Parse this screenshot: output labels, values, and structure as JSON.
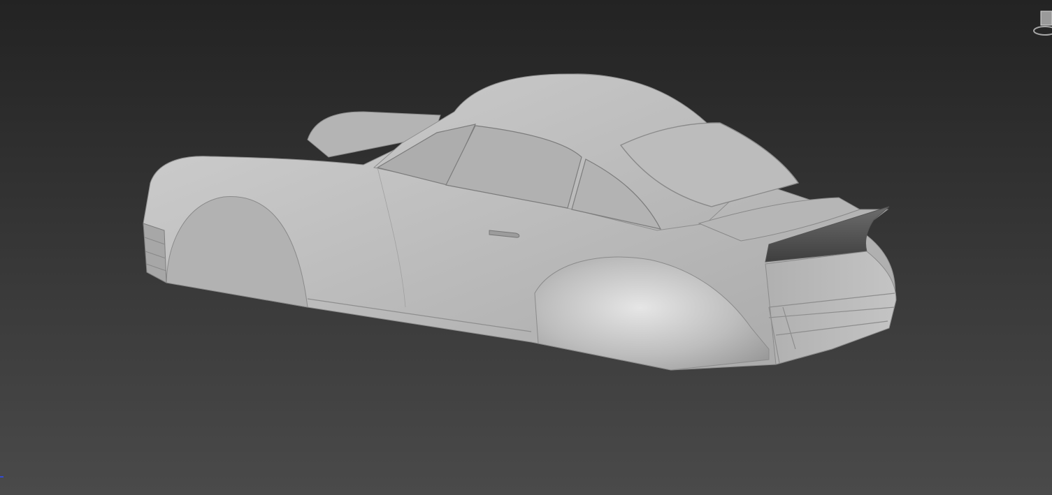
{
  "viewport": {
    "background_top": "#232323",
    "background_bottom": "#4b4b4b",
    "model_color": "#b9b9b9",
    "shading": "clay"
  },
  "model": {
    "object": "car-body-shell",
    "icon": "car-body-icon"
  },
  "viewcube": {
    "icon": "viewcube-icon"
  },
  "axis_tripod": {
    "icon": "axis-tripod-icon"
  }
}
